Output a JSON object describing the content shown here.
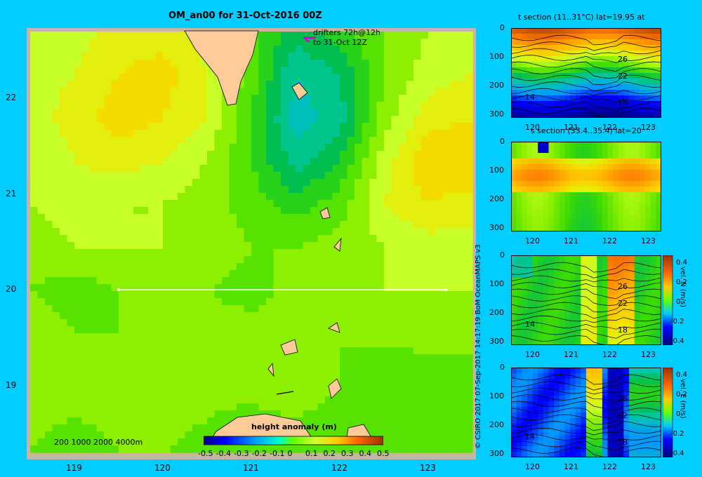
{
  "title": "OM_an00 for 31-Oct-2016 00Z",
  "drifters": {
    "line1": "drifters 72h@12h",
    "line2": "to 31-Oct 12Z"
  },
  "depth_legend": "200  1000  2000  4000m",
  "copyright": "© CSIRO 2017   07-Sep-2017 14:17:19 BoM OceanMAPS v3",
  "colorbar": {
    "title": "height anomaly  (m)",
    "labels": [
      "-0.5",
      "-0.4",
      "-0.3",
      "-0.2",
      "-0.1",
      "0",
      "0.1",
      "0.2",
      "0.3",
      "0.4",
      "0.5"
    ]
  },
  "colors": {
    "background": "#00ccff",
    "land": "#ffcc99",
    "shelf": "#c8b4a0",
    "frame": "#c8b4a0",
    "section_line": "#ffffff",
    "drifter": "#cc00cc"
  },
  "chart_data": [
    {
      "type": "heatmap",
      "title": "OM_an00 for 31-Oct-2016 00Z",
      "variable": "height anomaly (m)",
      "x_ticks": [
        "119",
        "120",
        "121",
        "122",
        "123"
      ],
      "y_ticks": [
        "22",
        "21",
        "20",
        "19"
      ],
      "xlim": [
        118.5,
        123.5
      ],
      "ylim": [
        18.3,
        22.7
      ],
      "section_line": {
        "lon": [
          119.5,
          123.2
        ],
        "lat": 20
      },
      "vmin": -0.5,
      "vmax": 0.5,
      "values": {
        "lon": [
          118.5,
          119.0,
          119.5,
          120.0,
          120.5,
          121.0,
          121.5,
          122.0,
          122.5,
          123.0,
          123.5
        ],
        "lat": [
          22.7,
          22.25,
          21.8,
          21.35,
          20.9,
          20.45,
          20.0,
          19.55,
          19.1,
          18.65,
          18.3
        ],
        "z": [
          [
            0.12,
            0.12,
            0.16,
            0.16,
            0.12,
            0.04,
            -0.04,
            0.0,
            0.06,
            0.1,
            0.1
          ],
          [
            0.12,
            0.14,
            0.18,
            0.2,
            0.14,
            0.04,
            -0.1,
            -0.06,
            0.06,
            0.12,
            0.14
          ],
          [
            0.12,
            0.16,
            0.2,
            0.18,
            0.14,
            0.02,
            -0.12,
            -0.08,
            0.08,
            0.16,
            0.18
          ],
          [
            0.1,
            0.14,
            0.16,
            0.14,
            0.1,
            0.02,
            -0.08,
            -0.02,
            0.12,
            0.22,
            0.22
          ],
          [
            0.1,
            0.12,
            0.1,
            0.1,
            0.08,
            0.04,
            0.0,
            0.04,
            0.14,
            0.18,
            0.16
          ],
          [
            0.08,
            0.1,
            0.1,
            0.1,
            0.1,
            0.06,
            0.06,
            0.08,
            0.1,
            0.12,
            0.12
          ],
          [
            0.06,
            0.04,
            0.06,
            0.08,
            0.06,
            0.04,
            0.08,
            0.1,
            0.1,
            0.1,
            0.1
          ],
          [
            0.08,
            0.06,
            0.06,
            0.08,
            0.08,
            0.08,
            0.08,
            0.06,
            0.08,
            0.08,
            0.08
          ],
          [
            0.08,
            0.08,
            0.1,
            0.1,
            0.08,
            0.1,
            0.1,
            0.06,
            0.02,
            0.04,
            0.04
          ],
          [
            0.08,
            0.06,
            0.08,
            0.08,
            0.06,
            0.04,
            0.06,
            0.04,
            0.02,
            0.04,
            0.04
          ],
          [
            0.06,
            0.02,
            0.06,
            0.06,
            0.04,
            0.04,
            0.06,
            0.04,
            0.04,
            0.04,
            0.04
          ]
        ]
      }
    },
    {
      "type": "heatmap",
      "title": "t section (11..31°C) lat=19.95 at",
      "x_ticks": [
        "120",
        "121",
        "122",
        "123"
      ],
      "y_ticks": [
        "0",
        "100",
        "200",
        "300"
      ],
      "contour_labels": [
        "26",
        "22",
        "18",
        "14"
      ],
      "ylim": [
        0,
        300
      ]
    },
    {
      "type": "heatmap",
      "title": "s section (33.4..35.4) lat=20",
      "x_ticks": [
        "120",
        "121",
        "122",
        "123"
      ],
      "y_ticks": [
        "0",
        "100",
        "200",
        "300"
      ],
      "ylim": [
        0,
        300
      ]
    },
    {
      "type": "heatmap",
      "title": "",
      "x_ticks": [
        "120",
        "121",
        "122",
        "123"
      ],
      "y_ticks": [
        "0",
        "100",
        "200",
        "300"
      ],
      "contour_labels": [
        "26",
        "22",
        "18",
        "14"
      ],
      "colorbar_label": "vel. N  (m/s)",
      "colorbar_ticks": [
        "0.4",
        "0.2",
        "0",
        "-0.2",
        "-0.4"
      ],
      "ylim": [
        0,
        300
      ]
    },
    {
      "type": "heatmap",
      "title": "",
      "x_ticks": [
        "120",
        "121",
        "122",
        "123"
      ],
      "y_ticks": [
        "0",
        "100",
        "200",
        "300"
      ],
      "contour_labels": [
        "26",
        "22",
        "18",
        "14"
      ],
      "colorbar_label": "vel. E  (m/s)",
      "colorbar_ticks": [
        "0.4",
        "0.2",
        "0",
        "-0.2",
        "-0.4"
      ],
      "ylim": [
        0,
        300
      ]
    }
  ]
}
